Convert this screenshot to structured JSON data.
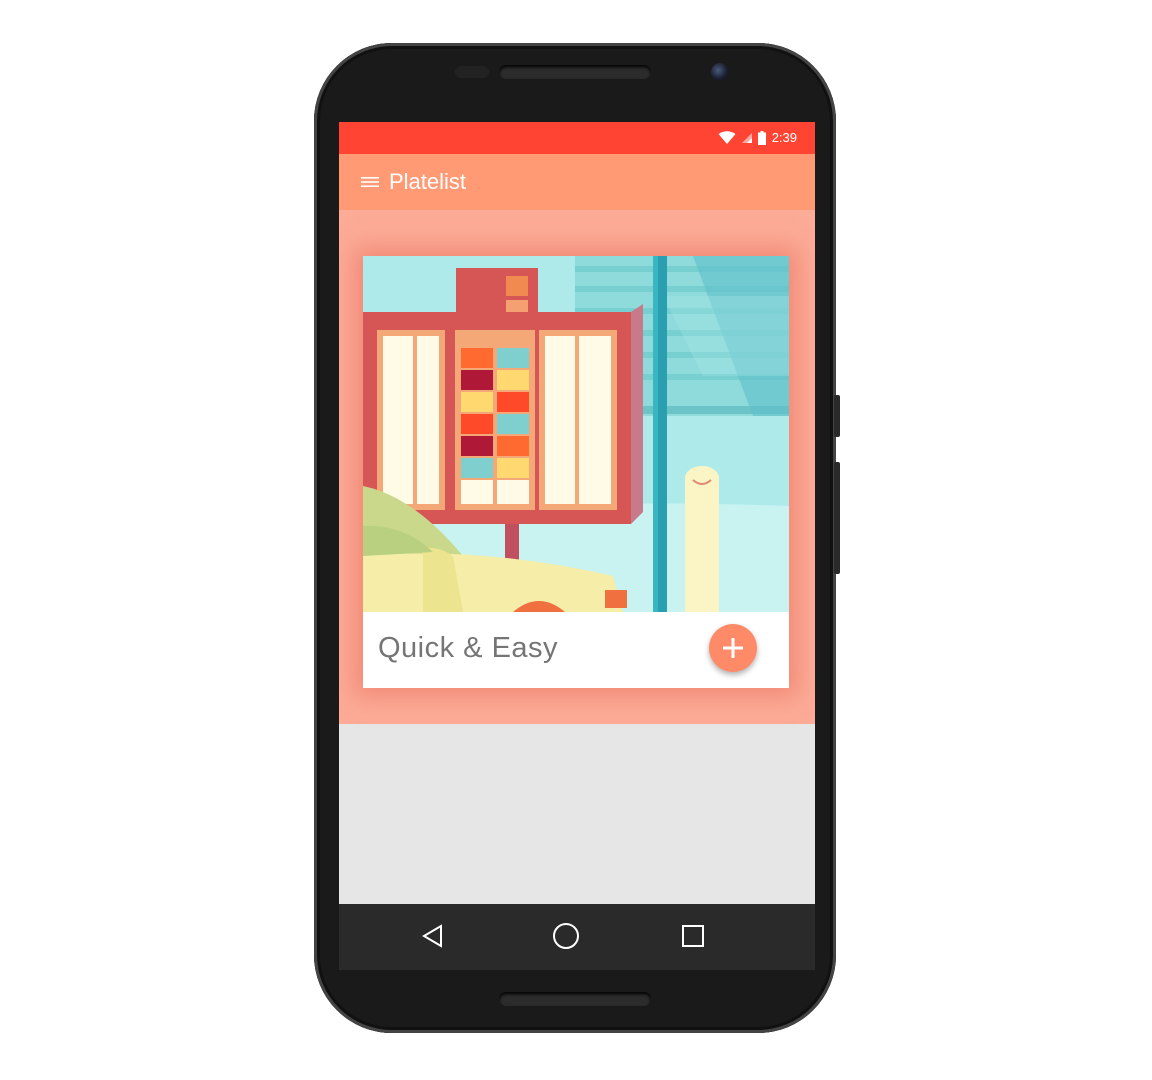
{
  "status_bar": {
    "time": "2:39",
    "wifi_icon": "wifi-icon",
    "signal_icon": "cell-signal-icon",
    "battery_icon": "battery-icon",
    "color": "#ff4433"
  },
  "app_bar": {
    "title": "Platelist",
    "menu_icon": "hamburger-menu-icon",
    "color": "#ff9a75"
  },
  "content": {
    "background_color": "#fcab97",
    "card": {
      "image": "drive-thru-menu-illustration",
      "title": "Quick & Easy",
      "action_icon": "plus-icon",
      "action_color": "#ff8a68"
    }
  },
  "nav_bar": {
    "back_icon": "back-triangle-icon",
    "home_icon": "home-circle-icon",
    "recents_icon": "recents-square-icon"
  }
}
